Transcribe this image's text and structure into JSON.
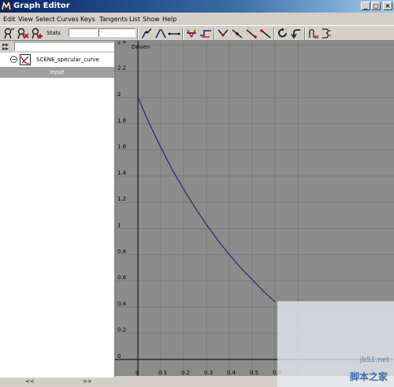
{
  "window": {
    "title": "Graph Editor",
    "minimize": "_",
    "maximize": "□",
    "close": "×"
  },
  "menu": [
    "Edit",
    "View",
    "Select",
    "Curves",
    "Keys",
    "Tangents",
    "List",
    "Show",
    "Help"
  ],
  "toolbar": {
    "stats_label": "Stats",
    "stats_field_1": "",
    "stats_field_2": "",
    "icons": [
      "move-key-icon",
      "insert-key-icon",
      "add-key-icon",
      "spline-tangent-icon",
      "clamped-tangent-icon",
      "linear-tangent-icon",
      "flat-tangent-icon",
      "step-tangent-icon",
      "plateau-tangent-icon",
      "break-tangent-icon",
      "unify-tangent-icon",
      "free-tangent-weight-icon",
      "lock-tangent-weight-icon",
      "cycle-icon",
      "undo-icon",
      "buffer-curve-icon",
      "swap-buffer-icon"
    ]
  },
  "outliner": {
    "filter_value": "",
    "curve_name": "SCENE_specular_curve",
    "input_label": "Input",
    "expand_symbol": "−"
  },
  "graph": {
    "y_ticks": [
      "2.4",
      "2.2",
      "2",
      "1.8",
      "1.6",
      "1.4",
      "1.2",
      "1",
      "0.8",
      "0.6",
      "0.4",
      "0.2",
      "0"
    ],
    "x_ticks": [
      "0",
      "0.1",
      "0.2",
      "0.3",
      "0.4",
      "0.5",
      "0.6"
    ],
    "axis_label": "Driven",
    "curve_color": "#25267a",
    "background_color": "#8c8c8c",
    "grid_color": "#7a7a7a"
  },
  "chart_data": {
    "type": "line",
    "x": [
      0,
      0.05,
      0.1,
      0.15,
      0.2,
      0.25,
      0.3,
      0.35,
      0.4,
      0.45,
      0.5,
      0.55,
      0.6
    ],
    "series": [
      {
        "values": [
          2.0,
          1.8,
          1.62,
          1.45,
          1.3,
          1.16,
          1.03,
          0.91,
          0.8,
          0.7,
          0.61,
          0.52,
          0.44
        ]
      }
    ],
    "xlim": [
      -0.1,
      0.6
    ],
    "ylim": [
      0,
      2.4
    ],
    "ylabel": "Driven",
    "grid": true
  },
  "status": {
    "left_arrows": "<<",
    "right_arrows": ">>"
  },
  "watermark": {
    "line1": "jb51.net",
    "line2": "脚本之家"
  }
}
